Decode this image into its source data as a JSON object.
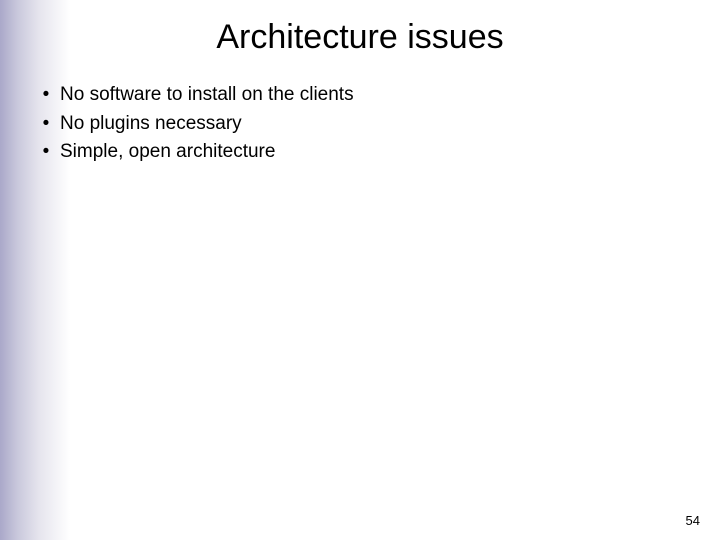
{
  "slide": {
    "title": "Architecture issues",
    "bullets": [
      "No software to install on the clients",
      "No plugins necessary",
      "Simple, open architecture"
    ],
    "page_number": "54"
  }
}
